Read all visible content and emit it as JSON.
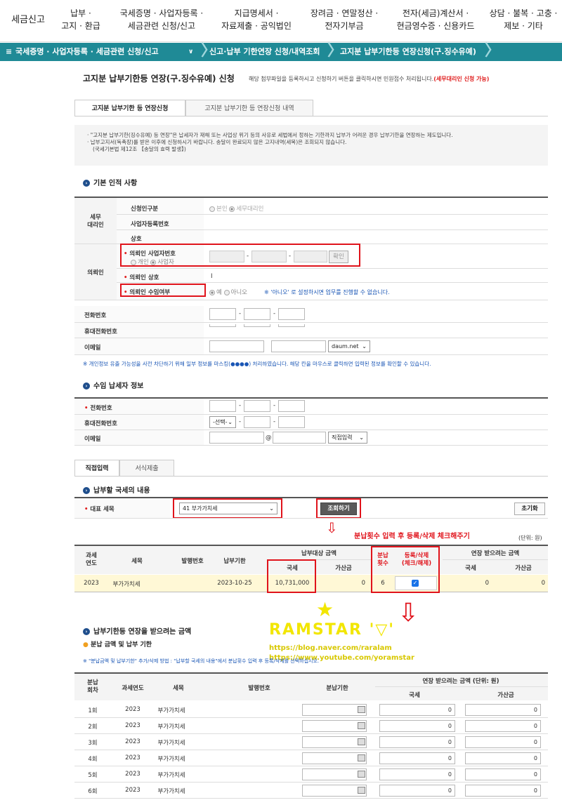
{
  "top_menu": [
    {
      "line1": "세금신고",
      "line2": ""
    },
    {
      "line1": "납부 ·",
      "line2": "고지 · 환급"
    },
    {
      "line1": "국세증명 · 사업자등록 ·",
      "line2": "세금관련 신청/신고"
    },
    {
      "line1": "지급명세서 ·",
      "line2": "자료제출 · 공익법인"
    },
    {
      "line1": "장려금 · 연말정산 ·",
      "line2": "전자기부금"
    },
    {
      "line1": "전자(세금)계산서 ·",
      "line2": "현금영수증 · 신용카드"
    },
    {
      "line1": "상담 · 불복 · 고충 ·",
      "line2": "제보 · 기타"
    }
  ],
  "breadcrumb": [
    "국세증명 · 사업자등록 · 세금관련 신청/신고",
    "신고·납부 기한연장 신청/내역조회",
    "고지분 납부기한등 연장신청(구.징수유예)"
  ],
  "page": {
    "title": "고지분 납부기한등 연장(구.징수유예) 신청",
    "desc": "해당 첨부파일을 등록하시고 신청하기 버튼을 클릭하시면 민원접수 처리됩니다.",
    "desc_red": "(세무대리인 신청 가능)"
  },
  "tabs": [
    "고지분 납부기한 등 연장신청",
    "고지분 납부기한 등 연장신청 내역"
  ],
  "notices": [
    "· \"고지분 납부기한(징수유예) 등 연장\"은 납세자가 재해 또는 사업상 위기 등의 사유로 세법에서 정하는 기한까지 납부가 어려운 경우 납부기한을 연장하는 제도입니다.",
    "· 납부고지서(독촉장)를 받은 이후에 신청하시기 바랍니다. 송달이 완료되지 않은 고지내역(세목)은 조회되지 않습니다.",
    "(국세기본법 제12조 【송달의 효력 발생】)"
  ],
  "basic": {
    "title": "기본 인적 사항",
    "agent_group": "세무\n대리인",
    "applicant_type_label": "신청인구분",
    "opt_self": "본인",
    "opt_agent": "세무대리인",
    "bizno_label": "사업자등록번호",
    "name_label": "상호",
    "client_group": "의뢰인",
    "client_bizno_label": "의뢰인 사업자번호",
    "opt_personal": "개인",
    "opt_business": "사업자",
    "confirm_btn": "확인",
    "client_name_label": "의뢰인 상호",
    "client_name_value": "I",
    "client_receive_label": "의뢰인 수임여부",
    "opt_yes": "예",
    "opt_no": "아니오",
    "receive_note": "※ '아니오' 로 설정하시면 업무를 진행할 수 없습니다.",
    "phone_label": "전화번호",
    "mobile_label": "휴대전화번호",
    "email_label": "이메일",
    "email_domain": "daum.net",
    "privacy_note": "※ 개인정보 유출 가능성을 사전 차단하기 위해 일부 정보를 마스킹(●●●●) 처리하였습니다. 해당 칸을 마우스로 클릭하면 입력된 정보를 확인할 수 있습니다."
  },
  "taxpayer": {
    "title": "수임 납세자 정보",
    "phone_label": "전화번호",
    "mobile_label": "휴대전화번호",
    "mobile_select": "-선택-",
    "email_label": "이메일",
    "at": "@",
    "email_select": "직접입력"
  },
  "tabs2": [
    "직접입력",
    "서식제출"
  ],
  "tax": {
    "title": "납부할 국세의 내용",
    "main_item_label": "대표 세목",
    "main_item_value": "41 부가가치세",
    "lookup_btn": "조회하기",
    "reset_btn": "초기화",
    "annotation": "분납횟수 입력 후 등록/삭제 체크해주기",
    "unit": "(단위: 원)",
    "headers": {
      "year": "과세\n연도",
      "item": "세목",
      "issue": "발행번호",
      "due": "납부기한",
      "target": "납부대상 금액",
      "tax": "국세",
      "addtax": "가산금",
      "count": "분납\n횟수",
      "reg": "등록/삭제\n(체크/해제)",
      "ext": "연장 받으려는 금액",
      "ext_tax": "국세",
      "ext_add": "가산금"
    },
    "row": {
      "year": "2023",
      "item": "부가가치세",
      "issue": "",
      "due": "2023-10-25",
      "tax": "10,731,000",
      "addtax": "0",
      "count": "6",
      "ext_tax": "0",
      "ext_add": "0"
    }
  },
  "watermark": {
    "star": "★",
    "name": "RAMSTAR '▽'",
    "url1": "https://blog.naver.com/raralam",
    "url2": "https://www.youtube.com/yoramstar"
  },
  "ext": {
    "title": "납부기한등 연장을 받으려는 금액",
    "subtitle": "분납 금액 및 납부 기한",
    "note": "※ \"분납금액 및 납부기한\" 추가/삭제 방법 : \"납부할 국세의 내용\"에서 분납횟수 입력 후 등록/삭제를 선택하십시오.",
    "headers": {
      "round": "분납\n회차",
      "year": "과세연도",
      "item": "세목",
      "issue": "발행번호",
      "due": "분납기한",
      "amount": "연장 받으려는 금액 (단위: 원)",
      "tax": "국세",
      "add": "가산금"
    },
    "rows": [
      {
        "round": "1회",
        "year": "2023",
        "item": "부가가치세",
        "tax": "0",
        "add": "0"
      },
      {
        "round": "2회",
        "year": "2023",
        "item": "부가가치세",
        "tax": "0",
        "add": "0"
      },
      {
        "round": "3회",
        "year": "2023",
        "item": "부가가치세",
        "tax": "0",
        "add": "0"
      },
      {
        "round": "4회",
        "year": "2023",
        "item": "부가가치세",
        "tax": "0",
        "add": "0"
      },
      {
        "round": "5회",
        "year": "2023",
        "item": "부가가치세",
        "tax": "0",
        "add": "0"
      },
      {
        "round": "6회",
        "year": "2023",
        "item": "부가가치세",
        "tax": "0",
        "add": "0"
      }
    ]
  }
}
